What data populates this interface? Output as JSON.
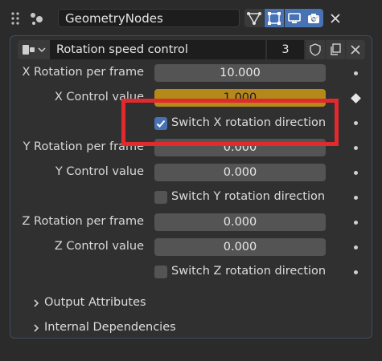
{
  "header": {
    "modifier_name": "GeometryNodes",
    "icons": [
      "grip-dots-icon",
      "geometry-nodes-icon",
      "node-tree-icon",
      "edit-mode-icon",
      "display-viewport-icon",
      "render-camera-icon",
      "chevron-down-icon",
      "close-icon"
    ]
  },
  "node_group": {
    "name": "Rotation speed control",
    "users": "3",
    "icons": [
      "node-group-type-icon",
      "fake-user-shield-icon",
      "duplicate-icon",
      "unlink-icon"
    ]
  },
  "properties": [
    {
      "label": "X Rotation per frame",
      "value": "10.000"
    },
    {
      "label": "X Control value",
      "value": "1.000"
    },
    {
      "checkbox_label": "Switch X rotation direction",
      "checked": true
    },
    {
      "label": "Y Rotation per frame",
      "value": "0.000"
    },
    {
      "label": "Y Control value",
      "value": "0.000"
    },
    {
      "checkbox_label": "Switch Y rotation direction",
      "checked": false
    },
    {
      "label": "Z Rotation per frame",
      "value": "0.000"
    },
    {
      "label": "Z Control value",
      "value": "0.000"
    },
    {
      "checkbox_label": "Switch Z rotation direction",
      "checked": false
    }
  ],
  "sections": [
    "Output Attributes",
    "Internal Dependencies"
  ],
  "colors": {
    "background": "#2b2b2b",
    "panel": "#303030",
    "field": "#545454",
    "driven_field": "#b5881a",
    "accent_blue": "#4772b3",
    "highlight_red": "#e02a2e"
  }
}
